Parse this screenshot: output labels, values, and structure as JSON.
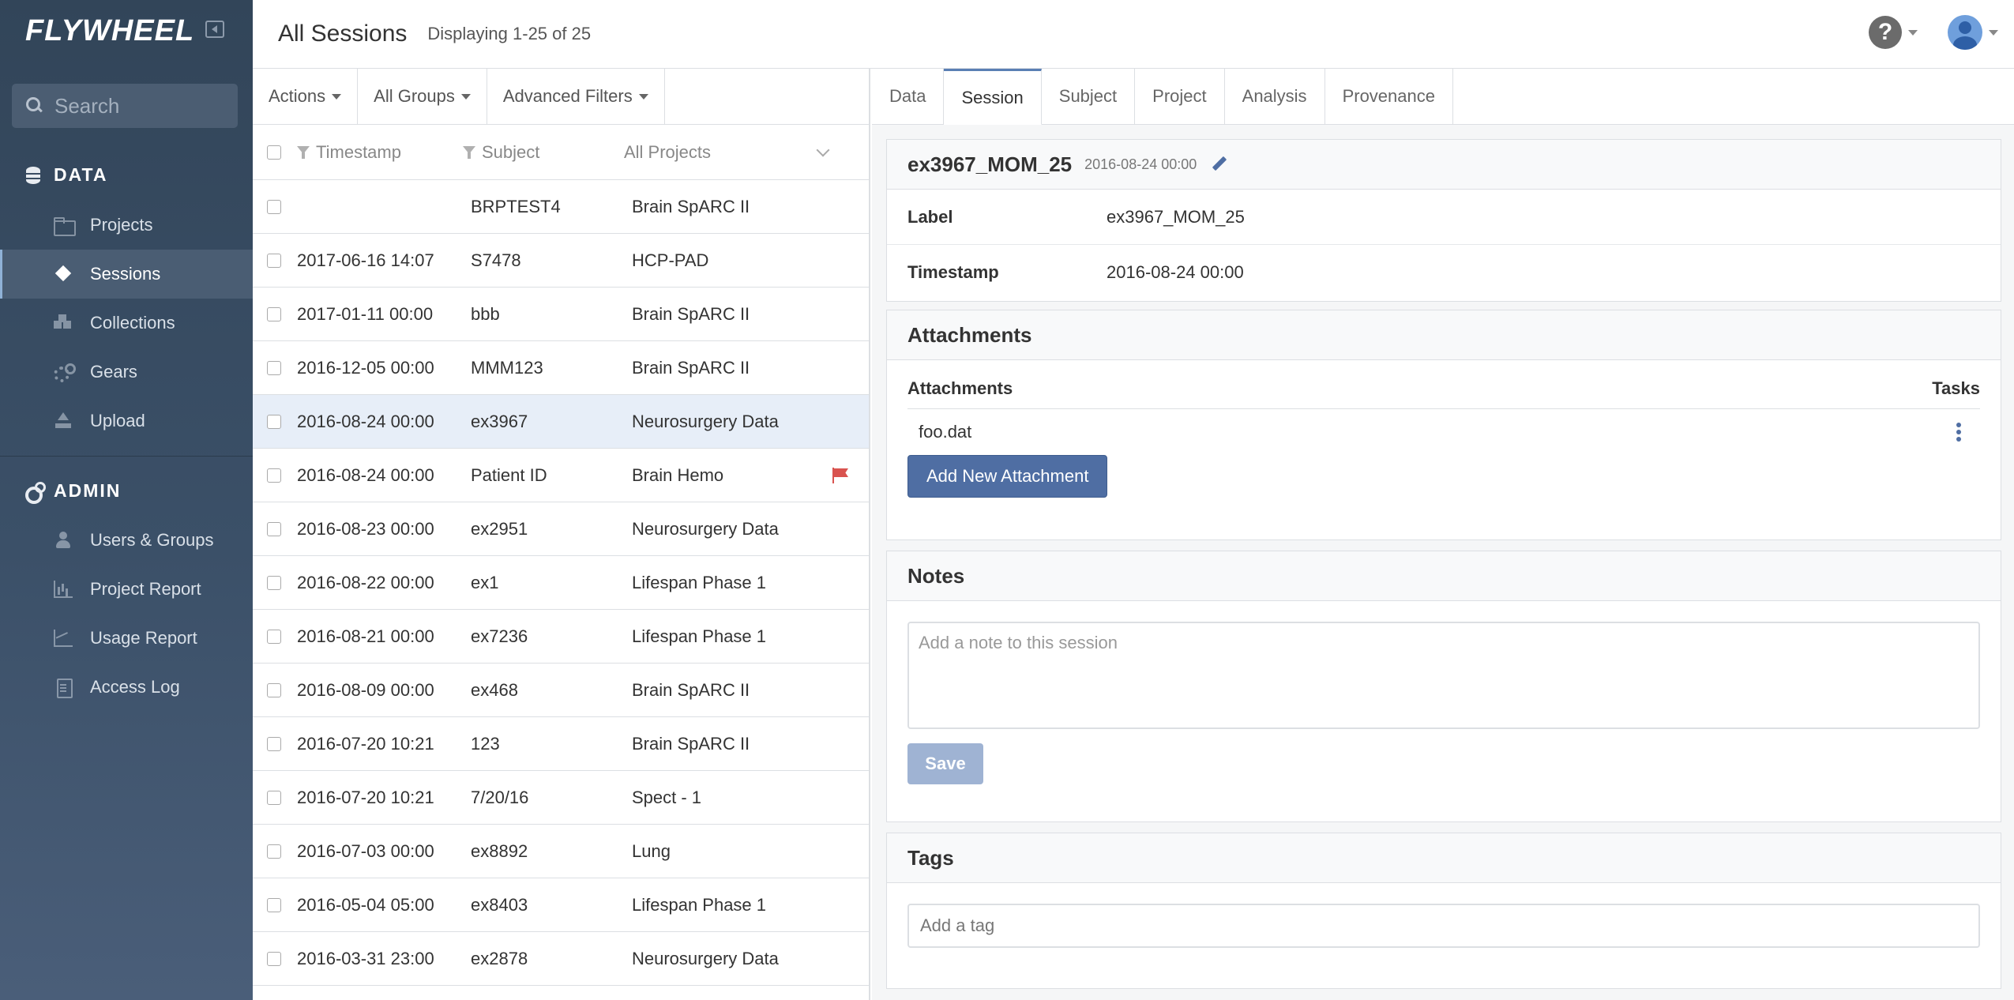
{
  "app": {
    "brand": "FLYWHEEL"
  },
  "sidebar": {
    "search_placeholder": "Search",
    "data_heading": "DATA",
    "admin_heading": "ADMIN",
    "data_items": [
      {
        "label": "Projects",
        "icon": "folder-icon"
      },
      {
        "label": "Sessions",
        "icon": "cube-icon",
        "active": true
      },
      {
        "label": "Collections",
        "icon": "cubes-icon"
      },
      {
        "label": "Gears",
        "icon": "gear-icon"
      },
      {
        "label": "Upload",
        "icon": "upload-icon"
      }
    ],
    "admin_items": [
      {
        "label": "Users & Groups",
        "icon": "user-icon"
      },
      {
        "label": "Project Report",
        "icon": "barchart-icon"
      },
      {
        "label": "Usage Report",
        "icon": "linechart-icon"
      },
      {
        "label": "Access Log",
        "icon": "file-icon"
      }
    ]
  },
  "header": {
    "title": "All Sessions",
    "count": "Displaying 1-25 of 25",
    "help_symbol": "?"
  },
  "toolbar": {
    "actions": "Actions",
    "groups": "All Groups",
    "filters": "Advanced Filters"
  },
  "list": {
    "columns": {
      "timestamp": "Timestamp",
      "subject": "Subject",
      "project": "All Projects"
    },
    "rows": [
      {
        "timestamp": "",
        "subject": "BRPTEST4",
        "project": "Brain SpARC II"
      },
      {
        "timestamp": "2017-06-16 14:07",
        "subject": "S7478",
        "project": "HCP-PAD"
      },
      {
        "timestamp": "2017-01-11 00:00",
        "subject": "bbb",
        "project": "Brain SpARC II"
      },
      {
        "timestamp": "2016-12-05 00:00",
        "subject": "MMM123",
        "project": "Brain SpARC II"
      },
      {
        "timestamp": "2016-08-24 00:00",
        "subject": "ex3967",
        "project": "Neurosurgery Data",
        "selected": true
      },
      {
        "timestamp": "2016-08-24 00:00",
        "subject": "Patient ID",
        "project": "Brain Hemo",
        "flagged": true
      },
      {
        "timestamp": "2016-08-23 00:00",
        "subject": "ex2951",
        "project": "Neurosurgery Data"
      },
      {
        "timestamp": "2016-08-22 00:00",
        "subject": "ex1",
        "project": "Lifespan Phase 1"
      },
      {
        "timestamp": "2016-08-21 00:00",
        "subject": "ex7236",
        "project": "Lifespan Phase 1"
      },
      {
        "timestamp": "2016-08-09 00:00",
        "subject": "ex468",
        "project": "Brain SpARC II"
      },
      {
        "timestamp": "2016-07-20 10:21",
        "subject": "123",
        "project": "Brain SpARC II"
      },
      {
        "timestamp": "2016-07-20 10:21",
        "subject": "7/20/16",
        "project": "Spect - 1"
      },
      {
        "timestamp": "2016-07-03 00:00",
        "subject": "ex8892",
        "project": "Lung"
      },
      {
        "timestamp": "2016-05-04 05:00",
        "subject": "ex8403",
        "project": "Lifespan Phase 1"
      },
      {
        "timestamp": "2016-03-31 23:00",
        "subject": "ex2878",
        "project": "Neurosurgery Data"
      }
    ]
  },
  "detail": {
    "tabs": [
      "Data",
      "Session",
      "Subject",
      "Project",
      "Analysis",
      "Provenance"
    ],
    "active_tab": "Session",
    "session": {
      "name": "ex3967_MOM_25",
      "date": "2016-08-24 00:00",
      "label_key": "Label",
      "label_value": "ex3967_MOM_25",
      "timestamp_key": "Timestamp",
      "timestamp_value": "2016-08-24 00:00"
    },
    "attachments": {
      "title": "Attachments",
      "col_name": "Attachments",
      "col_tasks": "Tasks",
      "files": [
        "foo.dat"
      ],
      "add_button": "Add New Attachment"
    },
    "notes": {
      "title": "Notes",
      "placeholder": "Add a note to this session",
      "save_button": "Save"
    },
    "tags": {
      "title": "Tags",
      "placeholder": "Add a tag"
    }
  },
  "colors": {
    "sidebar_bg": "#3b5068",
    "accent": "#4f6ea3",
    "selected_row": "#e7eef8",
    "flag": "#d9534f"
  }
}
